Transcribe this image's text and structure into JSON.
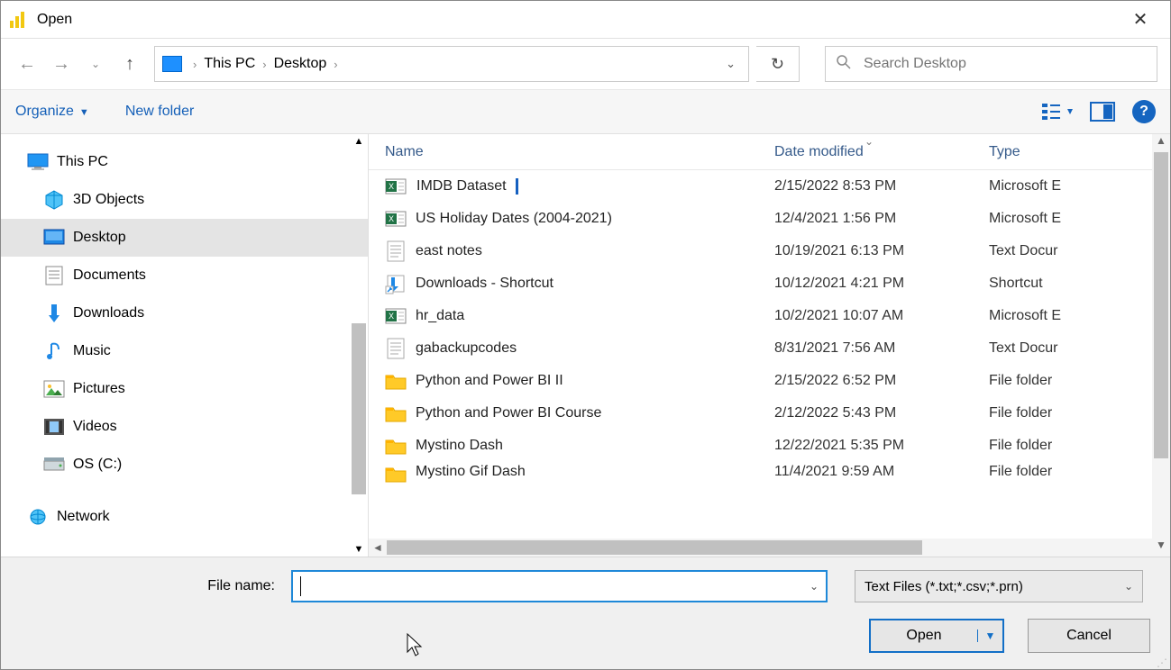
{
  "title": "Open",
  "nav": {
    "back_enabled": false,
    "forward_enabled": false,
    "up_enabled": true
  },
  "breadcrumbs": [
    "This PC",
    "Desktop"
  ],
  "search": {
    "placeholder": "Search Desktop"
  },
  "toolbar": {
    "organize_label": "Organize",
    "newfolder_label": "New folder"
  },
  "tree": [
    {
      "label": "This PC",
      "icon": "pc",
      "depth": 0
    },
    {
      "label": "3D Objects",
      "icon": "3d",
      "depth": 1
    },
    {
      "label": "Desktop",
      "icon": "desktop",
      "depth": 1,
      "selected": true
    },
    {
      "label": "Documents",
      "icon": "doc",
      "depth": 1
    },
    {
      "label": "Downloads",
      "icon": "dl",
      "depth": 1
    },
    {
      "label": "Music",
      "icon": "music",
      "depth": 1
    },
    {
      "label": "Pictures",
      "icon": "pic",
      "depth": 1
    },
    {
      "label": "Videos",
      "icon": "vid",
      "depth": 1
    },
    {
      "label": "OS (C:)",
      "icon": "drive",
      "depth": 1
    },
    {
      "label": "Network",
      "icon": "net",
      "depth": 0
    }
  ],
  "columns": {
    "name": "Name",
    "date": "Date modified",
    "type": "Type"
  },
  "files": [
    {
      "name": "IMDB Dataset",
      "date": "2/15/2022 8:53 PM",
      "type": "Microsoft E",
      "icon": "xls",
      "highlight": true
    },
    {
      "name": "US Holiday Dates (2004-2021)",
      "date": "12/4/2021 1:56 PM",
      "type": "Microsoft E",
      "icon": "xls"
    },
    {
      "name": "east notes",
      "date": "10/19/2021 6:13 PM",
      "type": "Text Docur",
      "icon": "txt"
    },
    {
      "name": "Downloads - Shortcut",
      "date": "10/12/2021 4:21 PM",
      "type": "Shortcut",
      "icon": "shortcut"
    },
    {
      "name": "hr_data",
      "date": "10/2/2021 10:07 AM",
      "type": "Microsoft E",
      "icon": "xls"
    },
    {
      "name": "gabackupcodes",
      "date": "8/31/2021 7:56 AM",
      "type": "Text Docur",
      "icon": "txt"
    },
    {
      "name": "Python and Power BI II",
      "date": "2/15/2022 6:52 PM",
      "type": "File folder",
      "icon": "folder"
    },
    {
      "name": "Python and Power BI Course",
      "date": "2/12/2022 5:43 PM",
      "type": "File folder",
      "icon": "folder"
    },
    {
      "name": "Mystino Dash",
      "date": "12/22/2021 5:35 PM",
      "type": "File folder",
      "icon": "folder"
    },
    {
      "name": "Mystino Gif Dash",
      "date": "11/4/2021 9:59 AM",
      "type": "File folder",
      "icon": "folder",
      "partial": true
    }
  ],
  "filename_label": "File name:",
  "filename_value": "",
  "filter": "Text Files (*.txt;*.csv;*.prn)",
  "open_label": "Open",
  "cancel_label": "Cancel"
}
